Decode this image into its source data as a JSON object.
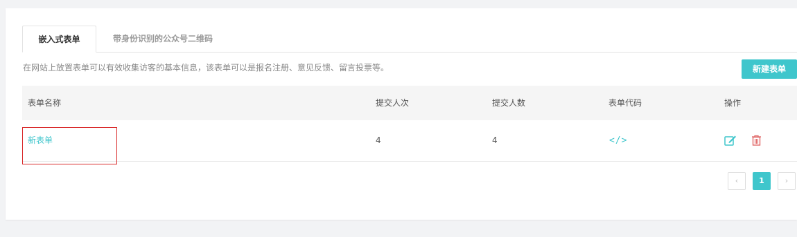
{
  "tabs": [
    {
      "label": "嵌入式表单",
      "active": true
    },
    {
      "label": "带身份识别的公众号二维码",
      "active": false
    }
  ],
  "description": "在网站上放置表单可以有效收集访客的基本信息，该表单可以是报名注册、意见反馈、留言投票等。",
  "new_button": "新建表单",
  "table": {
    "headers": [
      "表单名称",
      "提交人次",
      "提交人数",
      "表单代码",
      "操作"
    ],
    "rows": [
      {
        "name": "新表单",
        "submissions": "4",
        "submitters": "4",
        "code_icon": "</>",
        "actions": [
          "edit-icon",
          "delete-icon"
        ]
      }
    ]
  },
  "pagination": {
    "prev": "‹",
    "current": "1",
    "next": "›"
  },
  "colors": {
    "accent": "#3fc6cc",
    "danger": "#e06a6a",
    "highlight": "#d9292a"
  }
}
